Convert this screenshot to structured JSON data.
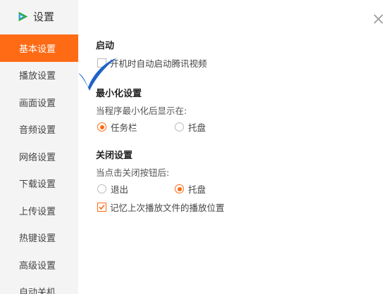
{
  "window": {
    "title": "设置"
  },
  "sidebar": {
    "items": [
      {
        "label": "基本设置",
        "active": true
      },
      {
        "label": "播放设置",
        "active": false
      },
      {
        "label": "画面设置",
        "active": false
      },
      {
        "label": "音频设置",
        "active": false
      },
      {
        "label": "网络设置",
        "active": false
      },
      {
        "label": "下载设置",
        "active": false
      },
      {
        "label": "上传设置",
        "active": false
      },
      {
        "label": "热键设置",
        "active": false
      },
      {
        "label": "高级设置",
        "active": false
      },
      {
        "label": "自动关机",
        "active": false
      }
    ]
  },
  "startup": {
    "title": "启动",
    "autostart_label": "开机时自动启动腾讯视频",
    "autostart_checked": true
  },
  "minimize": {
    "title": "最小化设置",
    "desc": "当程序最小化后显示在:",
    "options": [
      {
        "label": "任务栏",
        "selected": true
      },
      {
        "label": "托盘",
        "selected": false
      }
    ]
  },
  "close": {
    "title": "关闭设置",
    "desc": "当点击关闭按钮后:",
    "options": [
      {
        "label": "退出",
        "selected": false
      },
      {
        "label": "托盘",
        "selected": true
      }
    ],
    "remember_label": "记忆上次播放文件的播放位置",
    "remember_checked": true
  },
  "colors": {
    "accent": "#ff6a14",
    "check_mark": "#1f63c6",
    "sidebar_bg": "#f4f4f4"
  },
  "icons": {
    "logo": "tencent-video-logo",
    "close": "close-icon"
  }
}
